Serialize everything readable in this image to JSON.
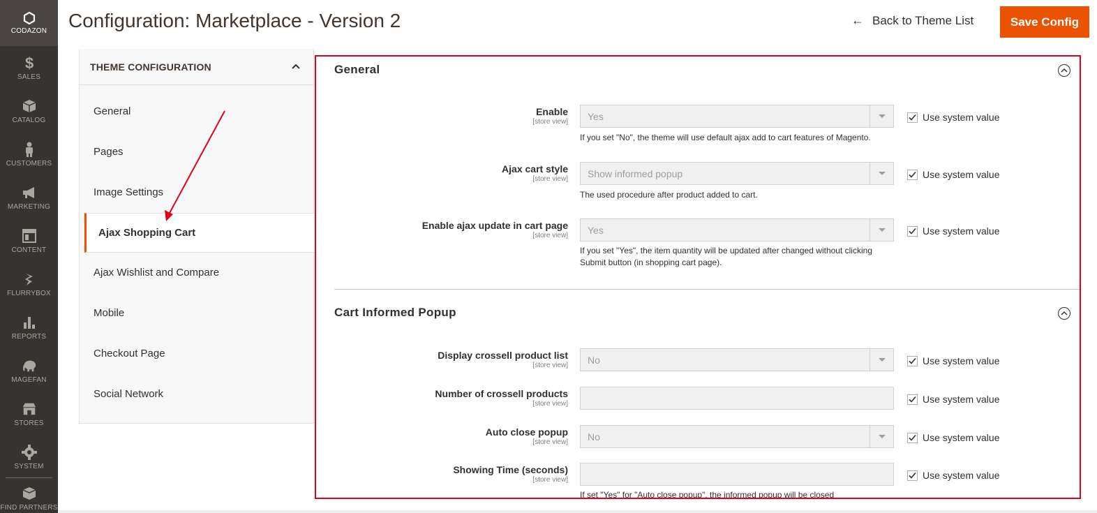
{
  "nav": {
    "logo_label": "CODAZON",
    "items": [
      {
        "label": "SALES",
        "icon": "dollar-icon"
      },
      {
        "label": "CATALOG",
        "icon": "cube-icon"
      },
      {
        "label": "CUSTOMERS",
        "icon": "person-icon"
      },
      {
        "label": "MARKETING",
        "icon": "megaphone-icon"
      },
      {
        "label": "CONTENT",
        "icon": "layout-icon"
      },
      {
        "label": "FLURRYBOX",
        "icon": "flurry-icon"
      },
      {
        "label": "REPORTS",
        "icon": "bar-chart-icon"
      },
      {
        "label": "MAGEFAN",
        "icon": "elephant-icon"
      },
      {
        "label": "STORES",
        "icon": "store-icon"
      },
      {
        "label": "SYSTEM",
        "icon": "gear-icon"
      },
      {
        "label": "FIND PARTNERS",
        "icon": "box-icon"
      }
    ]
  },
  "header": {
    "title": "Configuration: Marketplace - Version 2",
    "back_label": "Back to Theme List",
    "save_label": "Save Config"
  },
  "theme_config": {
    "title": "THEME CONFIGURATION",
    "items": [
      {
        "label": "General"
      },
      {
        "label": "Pages"
      },
      {
        "label": "Image Settings"
      },
      {
        "label": "Ajax Shopping Cart"
      },
      {
        "label": "Ajax Wishlist and Compare"
      },
      {
        "label": "Mobile"
      },
      {
        "label": "Checkout Page"
      },
      {
        "label": "Social Network"
      }
    ],
    "active_item": "Ajax Shopping Cart"
  },
  "sections": {
    "general": {
      "title": "General",
      "fields": [
        {
          "label": "Enable",
          "scope": "[store view]",
          "value": "Yes",
          "use_system_label": "Use system value",
          "note": "If you set \"No\", the theme will use default ajax add to cart features of Magento."
        },
        {
          "label": "Ajax cart style",
          "scope": "[store view]",
          "value": "Show informed popup",
          "use_system_label": "Use system value",
          "note": "The used procedure after product added to cart."
        },
        {
          "label": "Enable ajax update in cart page",
          "scope": "[store view]",
          "value": "Yes",
          "use_system_label": "Use system value",
          "note": "If you set \"Yes\", the item quantity will be updated after changed without clicking Submit button (in shopping cart page)."
        }
      ]
    },
    "popup": {
      "title": "Cart Informed Popup",
      "fields": [
        {
          "label": "Display crossell product list",
          "scope": "[store view]",
          "value": "No",
          "use_system_label": "Use system value"
        },
        {
          "label": "Number of crossell products",
          "scope": "[store view]",
          "value": "",
          "use_system_label": "Use system value"
        },
        {
          "label": "Auto close popup",
          "scope": "[store view]",
          "value": "No",
          "use_system_label": "Use system value"
        },
        {
          "label": "Showing Time (seconds)",
          "scope": "[store view]",
          "value": "",
          "use_system_label": "Use system value",
          "note": "If set \"Yes\" for \"Auto close popup\", the informed popup will be closed automatically after the period defined in this field."
        }
      ]
    }
  },
  "colors": {
    "accent": "#eb5202",
    "nav_bg": "#373330",
    "annotation": "#e3001b"
  }
}
